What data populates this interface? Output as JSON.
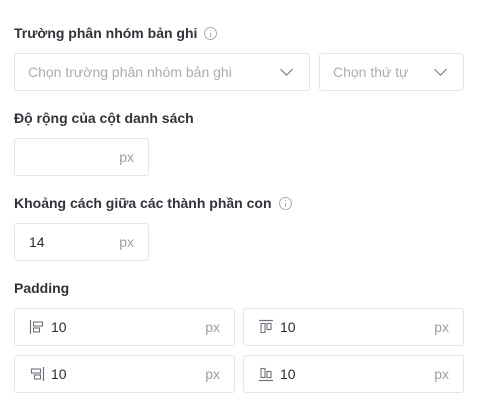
{
  "group_field": {
    "label": "Trường phân nhóm bản ghi",
    "field_placeholder": "Chọn trường phân nhóm bản ghi",
    "order_placeholder": "Chọn thứ tự",
    "info_icon": "info-icon"
  },
  "column_width": {
    "label": "Độ rộng của cột danh sách",
    "value": "",
    "unit": "px"
  },
  "child_spacing": {
    "label": "Khoảng cách giữa các thành phần con",
    "value": "14",
    "unit": "px",
    "info_icon": "info-icon"
  },
  "padding": {
    "label": "Padding",
    "left": {
      "value": "10",
      "unit": "px",
      "icon": "padding-left-icon"
    },
    "top": {
      "value": "10",
      "unit": "px",
      "icon": "padding-top-icon"
    },
    "right": {
      "value": "10",
      "unit": "px",
      "icon": "padding-right-icon"
    },
    "bottom": {
      "value": "10",
      "unit": "px",
      "icon": "padding-bottom-icon"
    }
  }
}
